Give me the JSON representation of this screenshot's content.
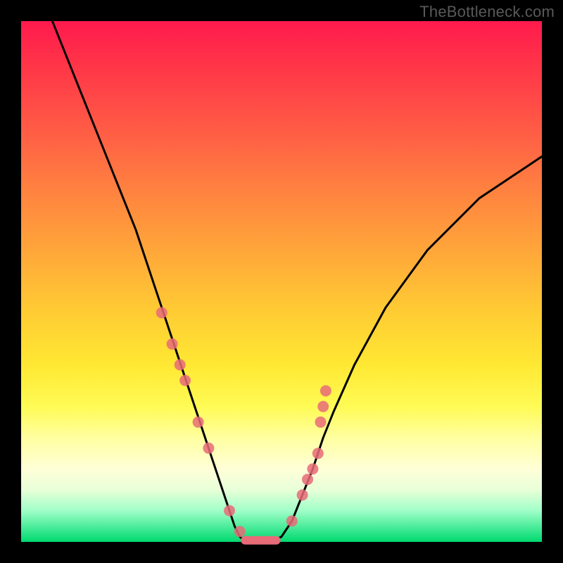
{
  "attribution": "TheBottleneck.com",
  "chart_data": {
    "type": "line",
    "title": "",
    "xlabel": "",
    "ylabel": "",
    "xlim": [
      0,
      100
    ],
    "ylim": [
      0,
      100
    ],
    "series": [
      {
        "name": "bottleneck-curve",
        "x": [
          6,
          10,
          14,
          18,
          22,
          26,
          28,
          30,
          32,
          34,
          36,
          38,
          40,
          41,
          42,
          43,
          44,
          46,
          48,
          50,
          52,
          54,
          56,
          58,
          60,
          64,
          70,
          78,
          88,
          100
        ],
        "y": [
          100,
          90,
          80,
          70,
          60,
          48,
          42,
          36,
          30,
          24,
          18,
          12,
          6,
          3,
          1,
          0,
          0,
          0,
          0,
          1,
          4,
          9,
          14,
          20,
          25,
          34,
          45,
          56,
          66,
          74
        ]
      }
    ],
    "scatter": [
      {
        "name": "points-left",
        "color": "#e86b78",
        "x": [
          27.0,
          29.0,
          30.5,
          31.5,
          34.0,
          36.0,
          40.0,
          42.0
        ],
        "y": [
          44.0,
          38.0,
          34.0,
          31.0,
          23.0,
          18.0,
          6.0,
          2.0
        ]
      },
      {
        "name": "points-right",
        "color": "#e86b78",
        "x": [
          52.0,
          54.0,
          55.0,
          56.0,
          57.0,
          57.5,
          58.0,
          58.5
        ],
        "y": [
          4.0,
          9.0,
          12.0,
          14.0,
          17.0,
          23.0,
          26.0,
          29.0
        ]
      }
    ],
    "flat_segment": {
      "x0": 43,
      "x1": 49,
      "y": 0.3,
      "color": "#e86b78"
    }
  },
  "colors": {
    "curve": "#000000",
    "points": "#e86b78",
    "attribution": "#595959"
  }
}
